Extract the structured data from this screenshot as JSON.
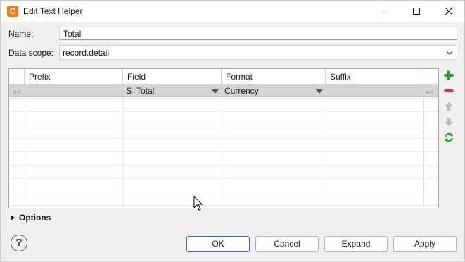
{
  "window": {
    "title": "Edit Text Helper",
    "app_icon_letter": "C"
  },
  "form": {
    "name_label": "Name:",
    "name_value": "Total",
    "scope_label": "Data scope:",
    "scope_value": "record.detail"
  },
  "grid": {
    "columns": [
      "Prefix",
      "Field",
      "Format",
      "Suffix"
    ],
    "rows": [
      {
        "prefix": "",
        "field_symbol": "$",
        "field": "Total",
        "format": "Currency",
        "suffix": ""
      }
    ]
  },
  "options": {
    "label": "Options"
  },
  "footer": {
    "help_label": "?",
    "ok_label": "OK",
    "cancel_label": "Cancel",
    "expand_label": "Expand",
    "apply_label": "Apply"
  },
  "colors": {
    "add": "#2e9e2e",
    "remove": "#d63a3a",
    "default_button_border": "#2b6fc7",
    "app_icon": "#f07a1e"
  }
}
